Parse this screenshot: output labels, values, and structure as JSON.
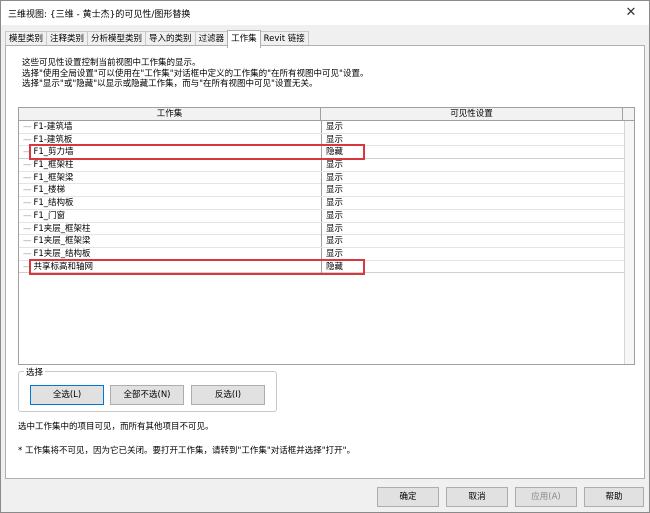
{
  "window": {
    "title": "三维视图: {三维 - 黄士杰}的可见性/图形替换",
    "close_glyph": "✕"
  },
  "tabs": [
    {
      "label": "模型类别"
    },
    {
      "label": "注释类别"
    },
    {
      "label": "分析模型类别"
    },
    {
      "label": "导入的类别"
    },
    {
      "label": "过滤器"
    },
    {
      "label": "工作集",
      "active": true
    },
    {
      "label": "Revit 链接"
    }
  ],
  "description": [
    "这些可见性设置控制当前视图中工作集的显示。",
    "选择\"使用全局设置\"可以使用在\"工作集\"对话框中定义的工作集的\"在所有视图中可见\"设置。",
    "选择\"显示\"或\"隐藏\"以显示或隐藏工作集，而与\"在所有视图中可见\"设置无关。"
  ],
  "table": {
    "headers": [
      "工作集",
      "可见性设置"
    ],
    "rows": [
      {
        "name": "F1-建筑墙",
        "visibility": "显示"
      },
      {
        "name": "F1-建筑板",
        "visibility": "显示"
      },
      {
        "name": "F1_剪力墙",
        "visibility": "隐藏",
        "highlighted": true
      },
      {
        "name": "F1_框架柱",
        "visibility": "显示"
      },
      {
        "name": "F1_框架梁",
        "visibility": "显示"
      },
      {
        "name": "F1_楼梯",
        "visibility": "显示"
      },
      {
        "name": "F1_结构板",
        "visibility": "显示"
      },
      {
        "name": "F1_门窗",
        "visibility": "显示"
      },
      {
        "name": "F1夹层_框架柱",
        "visibility": "显示"
      },
      {
        "name": "F1夹层_框架梁",
        "visibility": "显示"
      },
      {
        "name": "F1夹层_结构板",
        "visibility": "显示"
      },
      {
        "name": "共享标高和轴网",
        "visibility": "隐藏",
        "highlighted": true
      }
    ],
    "highlight_color": "#d9363e"
  },
  "select_group": {
    "legend": "选择",
    "select_all": "全选(L)",
    "select_none": "全部不选(N)",
    "invert": "反选(I)"
  },
  "notes": {
    "selected_visible": "选中工作集中的项目可见，而所有其他项目不可见。",
    "closed_worksets": "* 工作集将不可见，因为它已关闭。要打开工作集，请转到\"工作集\"对话框并选择\"打开\"。"
  },
  "footer": {
    "ok": "确定",
    "cancel": "取消",
    "apply": "应用(A)",
    "help": "帮助"
  }
}
